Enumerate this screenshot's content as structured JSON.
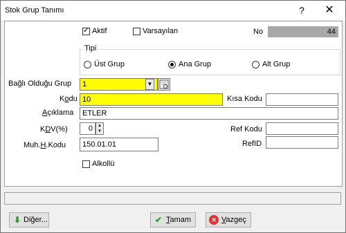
{
  "window": {
    "title": "Stok Grup Tanımı",
    "help": "?",
    "close": "✕"
  },
  "top": {
    "aktif_label": "Aktif",
    "aktif_checked": true,
    "varsayilan_label": "Varsayılan",
    "varsayilan_checked": false,
    "no_label": "No",
    "no_value": "44"
  },
  "tipi": {
    "title": "Tipi",
    "options": [
      "Üst Grup",
      "Ana Grup",
      "Alt Grup"
    ],
    "selected": "Ana Grup"
  },
  "form": {
    "bagli_label": "Bağlı Olduğu Grup",
    "bagli_value": "1",
    "kodu_label_pre": "K",
    "kodu_label_u": "o",
    "kodu_label_post": "du",
    "kodu_value": "10",
    "kisa_kodu_label": "Kısa Kodu",
    "kisa_kodu_value": "",
    "aciklama_label_u": "A",
    "aciklama_label_post": "çıklama",
    "aciklama_value": "ETLER",
    "kdv_label_pre": "K",
    "kdv_label_u": "D",
    "kdv_label_post": "V(%)",
    "kdv_value": "0",
    "ref_kodu_label": "Ref Kodu",
    "ref_kodu_value": "",
    "muh_label_pre": "Muh.",
    "muh_label_u": "H",
    "muh_label_post": ".Kodu",
    "muh_value": "150.01.01",
    "refid_label": "RefID",
    "refid_value": "",
    "alkollu_label": "Alkollü",
    "alkollu_checked": false
  },
  "buttons": {
    "diger_pre": "Di",
    "diger_u": "ğ",
    "diger_post": "er...",
    "tamam_u": "T",
    "tamam_post": "amam",
    "vazgec_u": "V",
    "vazgec_post": "azgeç"
  },
  "icons": {
    "diger": "down-arrow-icon",
    "tamam": "checkmark-icon",
    "vazgec": "cancel-icon",
    "lookup": "lookup-icon"
  },
  "colors": {
    "highlight": "#ffff00",
    "no_box": "#a8a8a8"
  }
}
